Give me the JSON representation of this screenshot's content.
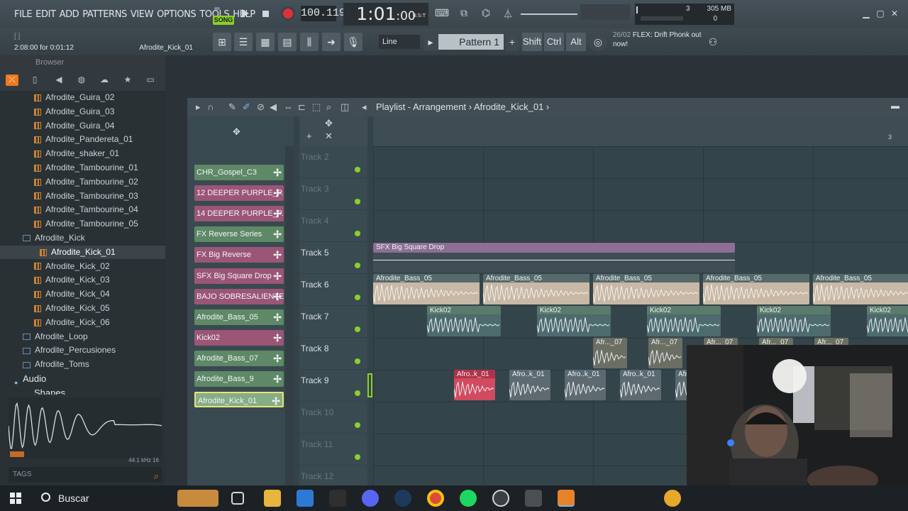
{
  "menu": [
    "FILE",
    "EDIT",
    "ADD",
    "PATTERNS",
    "VIEW",
    "OPTIONS",
    "TOOLS",
    "HELP"
  ],
  "transport": {
    "mode_label": "SONG",
    "tempo": "100.119",
    "time": "1:01",
    "time_ticks": ":00",
    "time_unit": "B:S:T"
  },
  "cpu": {
    "cores": "3",
    "memory": "305 MB",
    "polyphony": "0"
  },
  "hint_bar": {
    "top": "[ ]",
    "duration": "2:08:00 for 0:01:12",
    "sample": "Afrodite_Kick_01"
  },
  "snap": "Line",
  "pattern_selector": "Pattern 1",
  "keys": [
    "Shift",
    "Ctrl",
    "Alt"
  ],
  "news": {
    "date": "26/02",
    "text": "FLEX: Drift Phonk out now!"
  },
  "browser": {
    "title": "Browser",
    "items": [
      {
        "label": "Afrodite_Guira_02",
        "type": "file",
        "indent": 48
      },
      {
        "label": "Afrodite_Guira_03",
        "type": "file",
        "indent": 48
      },
      {
        "label": "Afrodite_Guira_04",
        "type": "file",
        "indent": 48
      },
      {
        "label": "Afrodite_Pandereta_01",
        "type": "file",
        "indent": 48
      },
      {
        "label": "Afrodite_shaker_01",
        "type": "file",
        "indent": 48
      },
      {
        "label": "Afrodite_Tambourine_01",
        "type": "file",
        "indent": 48
      },
      {
        "label": "Afrodite_Tambourine_02",
        "type": "file",
        "indent": 48
      },
      {
        "label": "Afrodite_Tambourine_03",
        "type": "file",
        "indent": 48
      },
      {
        "label": "Afrodite_Tambourine_04",
        "type": "file",
        "indent": 48
      },
      {
        "label": "Afrodite_Tambourine_05",
        "type": "file",
        "indent": 48
      },
      {
        "label": "Afrodite_Kick",
        "type": "folder",
        "indent": 32
      },
      {
        "label": "Afrodite_Kick_01",
        "type": "file",
        "indent": 56,
        "selected": true
      },
      {
        "label": "Afrodite_Kick_02",
        "type": "file",
        "indent": 48
      },
      {
        "label": "Afrodite_Kick_03",
        "type": "file",
        "indent": 48
      },
      {
        "label": "Afrodite_Kick_04",
        "type": "file",
        "indent": 48
      },
      {
        "label": "Afrodite_Kick_05",
        "type": "file",
        "indent": 48
      },
      {
        "label": "Afrodite_Kick_06",
        "type": "file",
        "indent": 48
      },
      {
        "label": "Afrodite_Loop",
        "type": "folder",
        "indent": 32
      },
      {
        "label": "Afrodite_Percusiones",
        "type": "folder",
        "indent": 32
      },
      {
        "label": "Afrodite_Toms",
        "type": "folder",
        "indent": 32
      },
      {
        "label": "Audio",
        "type": "root",
        "indent": 20
      },
      {
        "label": "Shapes",
        "type": "root",
        "indent": 36
      }
    ],
    "wave_info": "44.1 kHz 16",
    "tags_label": "TAGS"
  },
  "playlist": {
    "title": "Playlist - Arrangement",
    "current": "Afrodite_Kick_01",
    "bar_marker": "3",
    "patterns": [
      {
        "label": "CHR_Gospel_C3",
        "color": "green"
      },
      {
        "label": "12 DEEPER PURPLE_P...",
        "color": "pink"
      },
      {
        "label": "14 DEEPER PURPLE_P...",
        "color": "pink"
      },
      {
        "label": "FX Reverse Series",
        "color": "green"
      },
      {
        "label": "FX Big Reverse",
        "color": "pink"
      },
      {
        "label": "SFX Big Square Drop",
        "color": "pink"
      },
      {
        "label": "BAJO SOBRESALIENTE",
        "color": "pink"
      },
      {
        "label": "Afrodite_Bass_05",
        "color": "green"
      },
      {
        "label": "Kick02",
        "color": "pink"
      },
      {
        "label": "Afrodite_Bass_07",
        "color": "green"
      },
      {
        "label": "Afrodite_Bass_9",
        "color": "green"
      },
      {
        "label": "Afrodite_Kick_01",
        "color": "sel"
      }
    ],
    "tracks": [
      {
        "label": "Track 2",
        "dim": true
      },
      {
        "label": "Track 3",
        "dim": true
      },
      {
        "label": "Track 4",
        "dim": true
      },
      {
        "label": "Track 5",
        "dim": false
      },
      {
        "label": "Track 6",
        "dim": false
      },
      {
        "label": "Track 7",
        "dim": false
      },
      {
        "label": "Track 8",
        "dim": false
      },
      {
        "label": "Track 9",
        "dim": false
      },
      {
        "label": "Track 10",
        "dim": true
      },
      {
        "label": "Track 11",
        "dim": true
      },
      {
        "label": "Track 12",
        "dim": true
      }
    ],
    "clip_labels": {
      "sfx": "SFX Big Square Drop",
      "bass": "Afrodite_Bass_05",
      "kick": "Kick02",
      "afr7": "Afr..._07",
      "afk": "Afro..k_01"
    }
  },
  "taskbar": {
    "search_label": "Buscar"
  },
  "colors": {
    "accent": "#8ccf2a",
    "rec": "#e0303a",
    "browser_accent": "#ec7a20"
  }
}
